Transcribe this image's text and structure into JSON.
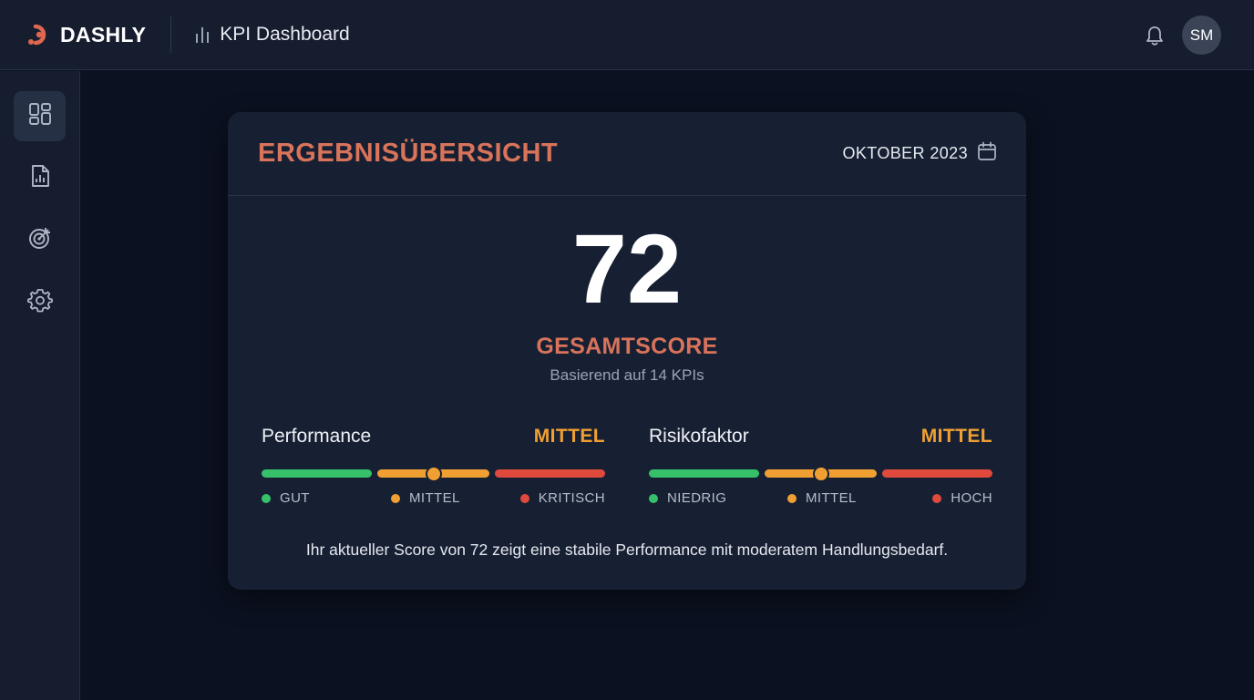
{
  "header": {
    "brand": "DASHLY",
    "page_title": "KPI Dashboard",
    "avatar_initials": "SM",
    "icons": {
      "logo": "dashly-logo-icon",
      "title": "bar-chart-icon",
      "notifications": "bell-icon"
    }
  },
  "sidebar": {
    "items": [
      {
        "icon": "dashboard-icon",
        "active": true
      },
      {
        "icon": "report-icon",
        "active": false
      },
      {
        "icon": "target-icon",
        "active": false
      },
      {
        "icon": "settings-icon",
        "active": false
      }
    ]
  },
  "card": {
    "title": "ERGEBNISÜBERSICHT",
    "period": "OKTOBER 2023",
    "score": "72",
    "score_label": "GESAMTSCORE",
    "score_subtitle": "Basierend auf 14 KPIs",
    "metrics": [
      {
        "name": "Performance",
        "status": "MITTEL",
        "level": 0.5,
        "legend": [
          "GUT",
          "MITTEL",
          "KRITISCH"
        ]
      },
      {
        "name": "Risikofaktor",
        "status": "MITTEL",
        "level": 0.5,
        "legend": [
          "NIEDRIG",
          "MITTEL",
          "HOCH"
        ]
      }
    ],
    "summary": "Ihr aktueller Score von 72 zeigt eine stabile Performance mit moderatem Handlungsbedarf."
  },
  "colors": {
    "accent": "#d9735a",
    "good": "#37c06a",
    "medium": "#f0a033",
    "critical": "#df4a3d",
    "background": "#0b1120",
    "panel": "#172033"
  }
}
